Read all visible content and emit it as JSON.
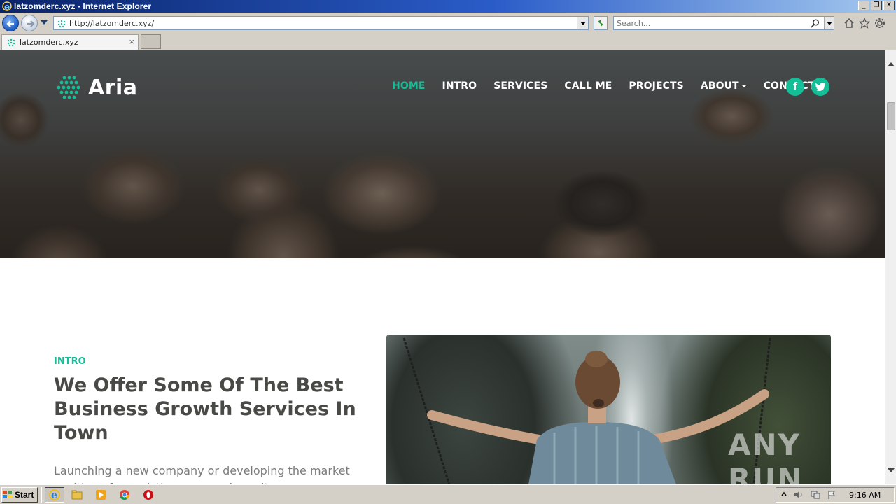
{
  "window": {
    "title": "latzomderc.xyz - Internet Explorer",
    "minimize": "_",
    "restore": "❐",
    "close": "✕"
  },
  "address": {
    "url": "http://latzomderc.xyz/"
  },
  "search": {
    "placeholder": "Search..."
  },
  "tabs": [
    {
      "label": "latzomderc.xyz",
      "close": "×"
    }
  ],
  "site": {
    "brand": "Aria",
    "nav": [
      "HOME",
      "INTRO",
      "SERVICES",
      "CALL ME",
      "PROJECTS",
      "ABOUT",
      "CONTACT"
    ],
    "social": [
      "f",
      "t"
    ],
    "intro_label": "INTRO",
    "intro_heading": "We Offer Some Of The Best Business Growth Services In Town",
    "intro_body": "Launching a new company or developing the market position of an existing one can be quite an overwhelming process"
  },
  "watermark": "ANY RUN",
  "taskbar": {
    "start": "Start",
    "clock": "9:16 AM"
  },
  "colors": {
    "accent": "#14bf98",
    "heading": "#484a46"
  }
}
